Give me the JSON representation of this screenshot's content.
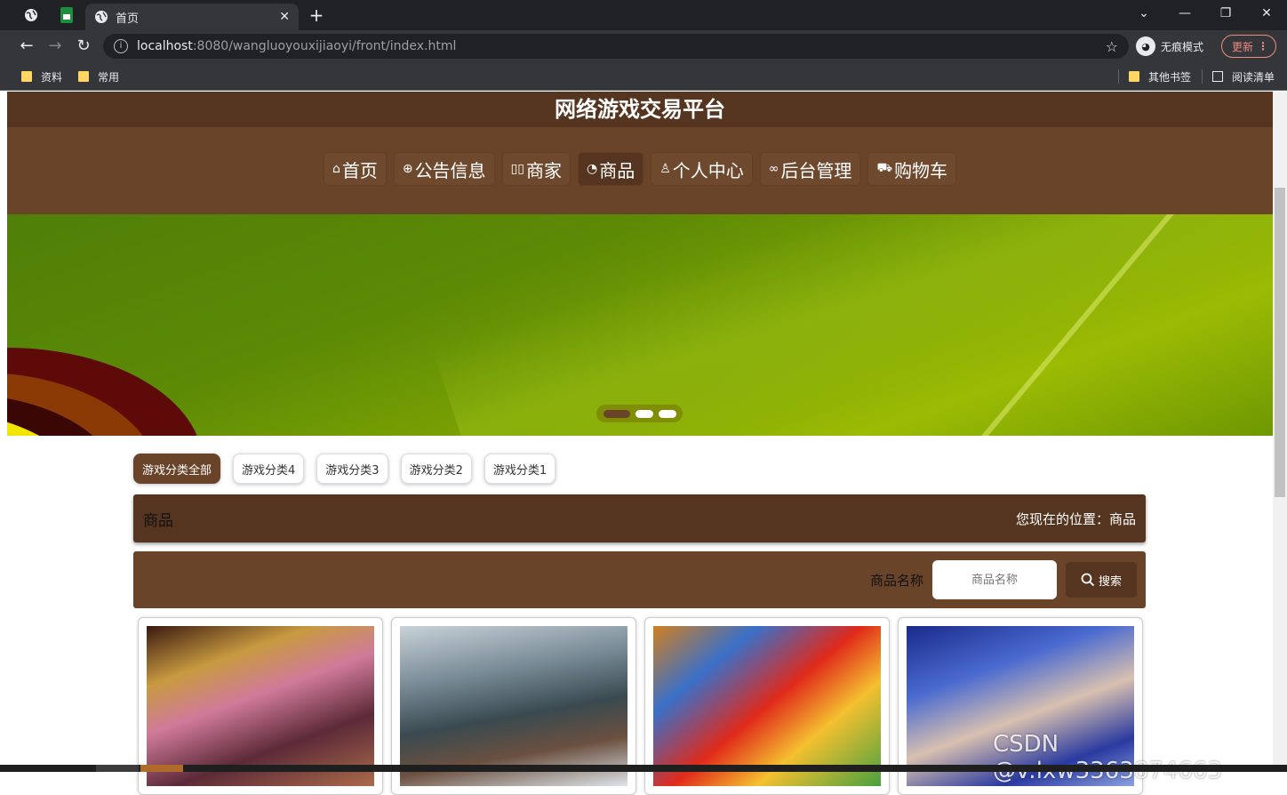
{
  "browser": {
    "tab_title": "首页",
    "url_host": "localhost",
    "url_rest": ":8080/wangluoyouxijiaoyi/front/index.html",
    "incognito_label": "无痕模式",
    "update_label": "更新",
    "bookmarks": [
      "资料",
      "常用"
    ],
    "other_bookmarks": "其他书签",
    "reading_list": "阅读清单"
  },
  "site": {
    "title": "网络游戏交易平台",
    "nav": [
      {
        "icon": "⌂",
        "label": "首页"
      },
      {
        "icon": "⊕",
        "label": "公告信息"
      },
      {
        "icon": "▯▯",
        "label": "商家"
      },
      {
        "icon": "◔",
        "label": "商品"
      },
      {
        "icon": "♙",
        "label": "个人中心"
      },
      {
        "icon": "∞",
        "label": "后台管理"
      },
      {
        "icon": "⛟",
        "label": "购物车"
      }
    ],
    "active_nav": "商品",
    "carousel": {
      "slides": 3,
      "active": 1
    }
  },
  "categories": [
    "游戏分类全部",
    "游戏分类4",
    "游戏分类3",
    "游戏分类2",
    "游戏分类1"
  ],
  "breadcrumb": {
    "title": "商品",
    "position": "您现在的位置：商品"
  },
  "search": {
    "label": "商品名称",
    "placeholder": "商品名称",
    "button": "搜索"
  },
  "products": [
    {
      "image": "game-art-1"
    },
    {
      "image": "game-art-2"
    },
    {
      "image": "game-art-3"
    },
    {
      "image": "game-art-4"
    }
  ],
  "watermark": "CSDN @v:lxw3363874663",
  "colors": {
    "primary": "#6a4428",
    "dark": "#563520"
  }
}
